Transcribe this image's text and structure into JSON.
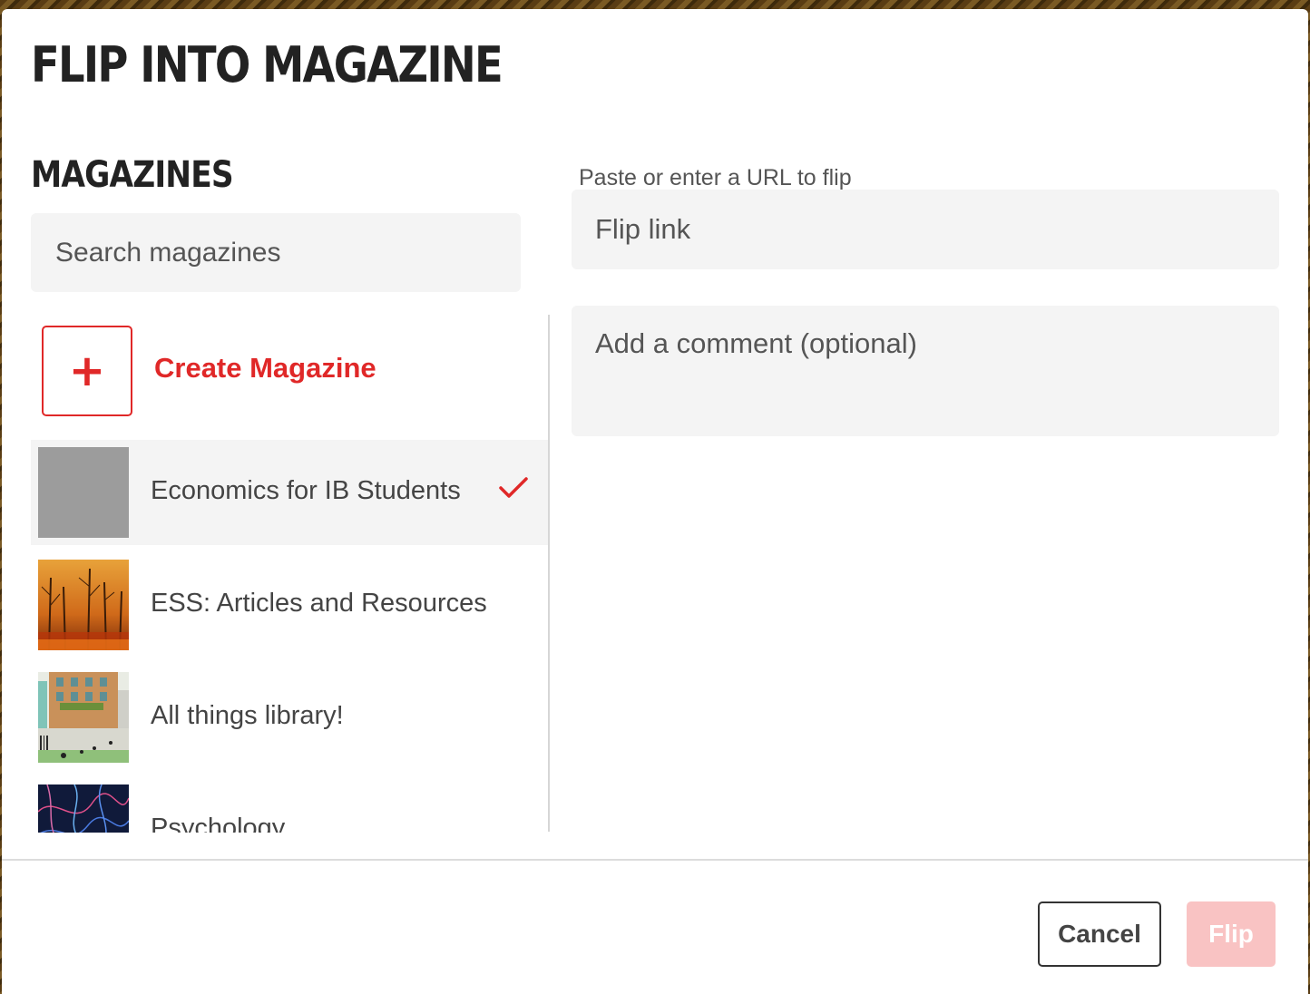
{
  "modal": {
    "title": "FLIP INTO MAGAZINE"
  },
  "magazines": {
    "heading": "MAGAZINES",
    "search_placeholder": "Search magazines",
    "create_label": "Create Magazine",
    "create_icon": "plus-icon",
    "items": [
      {
        "label": "Economics for IB Students",
        "selected": true,
        "thumb": "gray-placeholder"
      },
      {
        "label": "ESS: Articles and Resources",
        "selected": false,
        "thumb": "forest-fire-image"
      },
      {
        "label": "All things library!",
        "selected": false,
        "thumb": "library-illustration"
      },
      {
        "label": "Psychology",
        "selected": false,
        "thumb": "neuron-network-image"
      }
    ]
  },
  "flip_form": {
    "url_label": "Paste or enter a URL to flip",
    "url_placeholder": "Flip link",
    "comment_placeholder": "Add a comment (optional)"
  },
  "footer": {
    "cancel_label": "Cancel",
    "flip_label": "Flip"
  },
  "colors": {
    "accent": "#e02828",
    "flip_disabled": "#f9c3c3",
    "field_bg": "#f4f4f4"
  }
}
